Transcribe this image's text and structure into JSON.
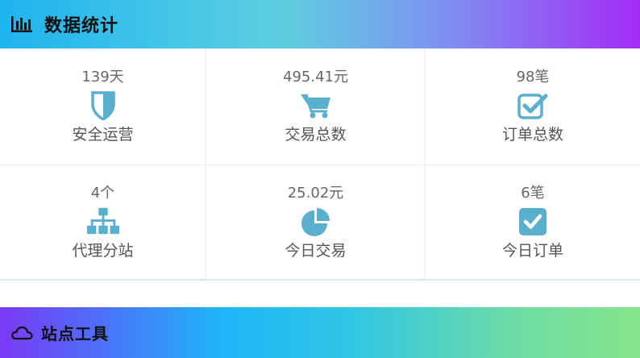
{
  "stats_panel": {
    "title": "数据统计",
    "icon": "bar-chart-icon",
    "cells": [
      {
        "value": "139天",
        "label": "安全运营",
        "icon": "shield-icon"
      },
      {
        "value": "495.41元",
        "label": "交易总数",
        "icon": "cart-icon"
      },
      {
        "value": "98笔",
        "label": "订单总数",
        "icon": "checkbox-edit-icon"
      },
      {
        "value": "4个",
        "label": "代理分站",
        "icon": "sitemap-icon"
      },
      {
        "value": "25.02元",
        "label": "今日交易",
        "icon": "pie-chart-icon"
      },
      {
        "value": "6笔",
        "label": "今日订单",
        "icon": "check-square-icon"
      }
    ],
    "icon_color": "#5aafcc"
  },
  "tools_panel": {
    "title": "站点工具",
    "icon": "cloud-icon"
  }
}
